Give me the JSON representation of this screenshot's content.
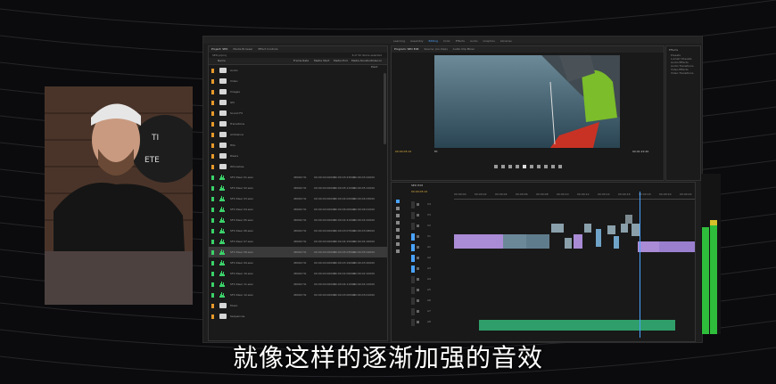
{
  "subtitle": "就像这样的逐渐加强的音效",
  "webcam": {
    "sign_lines": [
      "TI",
      "ETE"
    ]
  },
  "app": {
    "workspace_tabs": [
      "Learning",
      "Assembly",
      "Editing",
      "Color",
      "Effects",
      "Audio",
      "Graphics",
      "Libraries"
    ],
    "active_workspace": "Editing"
  },
  "project_panel": {
    "tabs": [
      "Project: SEO",
      "Media Browser",
      "Effect Controls"
    ],
    "path": "SEO.prproj",
    "item_count": "6 of 32 items selected",
    "columns": [
      "Name",
      "Frame Rate",
      "Media Start",
      "Media End",
      "Media Duration",
      "Video In Point"
    ],
    "rows": [
      {
        "type": "folder",
        "name": "Audio",
        "color": "#e89a2a"
      },
      {
        "type": "folder",
        "name": "Video",
        "color": "#e89a2a"
      },
      {
        "type": "folder",
        "name": "Images",
        "color": "#e89a2a"
      },
      {
        "type": "folder",
        "name": "Gfx",
        "color": "#e89a2a"
      },
      {
        "type": "folder",
        "name": "Sound FX",
        "color": "#e89a2a"
      },
      {
        "type": "folder",
        "name": "Transitions",
        "color": "#e89a2a"
      },
      {
        "type": "folder",
        "name": "Ambience",
        "color": "#e89a2a"
      },
      {
        "type": "folder",
        "name": "Hits",
        "color": "#e89a2a"
      },
      {
        "type": "folder",
        "name": "Risers",
        "color": "#e89a2a"
      },
      {
        "type": "folder",
        "name": "Whooshes",
        "color": "#e89a2a"
      },
      {
        "type": "audio",
        "name": "SFX Riser 01.wav",
        "fr": "48000 Hz",
        "ms": "00:00:00:00000",
        "me": "00:00:03:23999",
        "md": "00:00:03:24000",
        "color": "#3bd26a"
      },
      {
        "type": "audio",
        "name": "SFX Riser 02.wav",
        "fr": "48000 Hz",
        "ms": "00:00:00:00000",
        "me": "00:00:05:11999",
        "md": "00:00:05:12000",
        "color": "#3bd26a"
      },
      {
        "type": "audio",
        "name": "SFX Riser 03.wav",
        "fr": "48000 Hz",
        "ms": "00:00:00:00000",
        "me": "00:00:04:02999",
        "md": "00:00:04:03000",
        "color": "#3bd26a"
      },
      {
        "type": "audio",
        "name": "SFX Riser 04.wav",
        "fr": "48000 Hz",
        "ms": "00:00:00:00000",
        "me": "00:00:06:00999",
        "md": "00:00:06:01000",
        "color": "#3bd26a"
      },
      {
        "type": "audio",
        "name": "SFX Riser 05.wav",
        "fr": "48000 Hz",
        "ms": "00:00:00:00000",
        "me": "00:00:02:21999",
        "md": "00:00:02:22000",
        "color": "#3bd26a"
      },
      {
        "type": "audio",
        "name": "SFX Riser 06.wav",
        "fr": "48000 Hz",
        "ms": "00:00:00:00000",
        "me": "00:00:03:07999",
        "md": "00:00:03:08000",
        "color": "#3bd26a"
      },
      {
        "type": "audio",
        "name": "SFX Riser 07.wav",
        "fr": "48000 Hz",
        "ms": "00:00:00:00000",
        "me": "00:00:04:15999",
        "md": "00:00:04:16000",
        "color": "#3bd26a"
      },
      {
        "type": "audio",
        "name": "SFX Riser 08.wav",
        "fr": "48000 Hz",
        "ms": "00:00:00:00000",
        "me": "00:00:05:03999",
        "md": "00:00:05:04000",
        "color": "#3bd26a",
        "selected": true
      },
      {
        "type": "audio",
        "name": "SFX Riser 09.wav",
        "fr": "48000 Hz",
        "ms": "00:00:00:00000",
        "me": "00:00:03:19999",
        "md": "00:00:03:20000",
        "color": "#3bd26a"
      },
      {
        "type": "audio",
        "name": "SFX Riser 10.wav",
        "fr": "48000 Hz",
        "ms": "00:00:00:00000",
        "me": "00:00:02:09999",
        "md": "00:00:02:10000",
        "color": "#3bd26a"
      },
      {
        "type": "audio",
        "name": "SFX Riser 11.wav",
        "fr": "48000 Hz",
        "ms": "00:00:00:00000",
        "me": "00:00:04:11999",
        "md": "00:00:04:12000",
        "color": "#3bd26a"
      },
      {
        "type": "audio",
        "name": "SFX Riser 12.wav",
        "fr": "48000 Hz",
        "ms": "00:00:00:00000",
        "me": "00:00:03:00999",
        "md": "00:00:03:01000",
        "color": "#3bd26a"
      },
      {
        "type": "folder",
        "name": "Music",
        "color": "#e89a2a"
      },
      {
        "type": "folder",
        "name": "Sequences",
        "color": "#e89a2a"
      }
    ]
  },
  "program_monitor": {
    "tabs": [
      "Program: SEO Edit",
      "Source: (no clips)",
      "Audio Clip Mixer"
    ],
    "timecode_in": "00:00:05:12",
    "zoom": "Fit",
    "timecode_dur": "00:01:22:20"
  },
  "effects_panel": {
    "title": "Effects",
    "items": [
      "Presets",
      "Lumetri Presets",
      "Audio Effects",
      "Audio Transitions",
      "Video Effects",
      "Video Transitions"
    ]
  },
  "timeline": {
    "tab": "SEO Edit",
    "timecode": "00:00:05:12",
    "ruler": [
      "00:00:00",
      "00:00:02",
      "00:00:04",
      "00:00:06",
      "00:00:08",
      "00:00:10",
      "00:00:12",
      "00:00:14",
      "00:00:16",
      "00:00:18",
      "00:00:20",
      "00:00:22"
    ],
    "tracks": [
      "V4",
      "V3",
      "V2",
      "V1",
      "A1",
      "A2",
      "A3",
      "A4",
      "A5",
      "A6",
      "A7",
      "A8"
    ]
  },
  "colors": {
    "audio_clip": "#2f9e6a",
    "video_clip": "#a98bd6",
    "accent": "#4aa3ff",
    "meter": "#2fbd3c"
  }
}
